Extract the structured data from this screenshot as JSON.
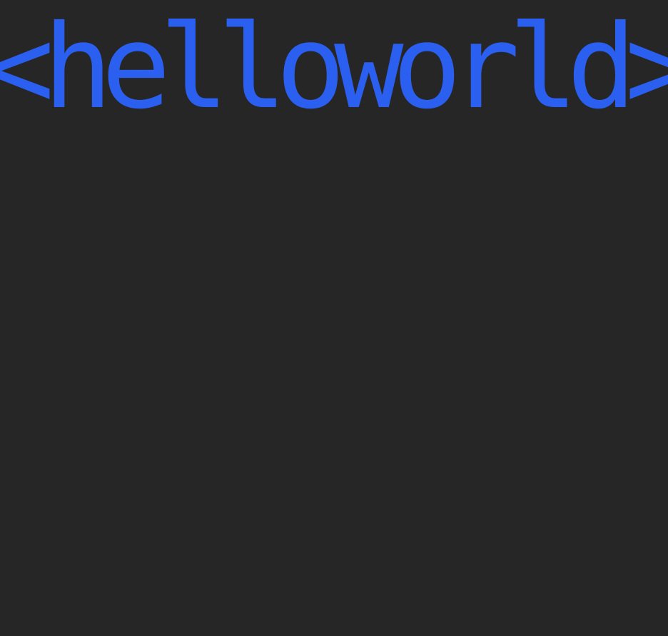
{
  "headline": {
    "text": "<helloworld>",
    "color": "#2a5ff0"
  },
  "background_color": "#262626"
}
